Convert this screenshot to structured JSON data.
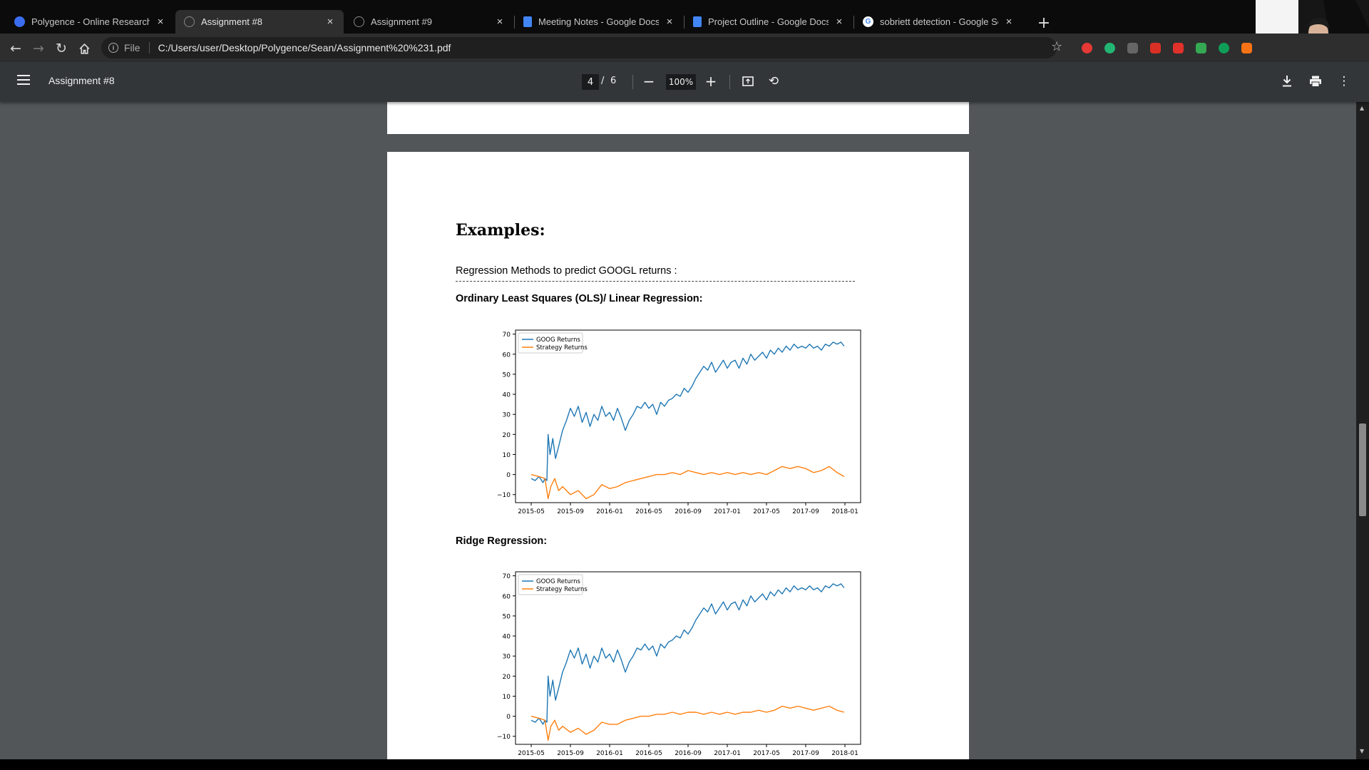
{
  "browser": {
    "tabs": [
      {
        "title": "Polygence - Online Research Opp",
        "icon": "polygence-icon",
        "color": "#3b6df0",
        "active": false
      },
      {
        "title": "Assignment #8",
        "icon": "globe-icon",
        "color": "#888888",
        "active": true
      },
      {
        "title": "Assignment #9",
        "icon": "globe-icon",
        "color": "#888888",
        "active": false
      },
      {
        "title": "Meeting Notes - Google Docs",
        "icon": "google-docs-icon",
        "color": "#4285f4",
        "active": false
      },
      {
        "title": "Project Outline - Google Docs",
        "icon": "google-docs-icon",
        "color": "#4285f4",
        "active": false
      },
      {
        "title": "sobriett detection - Google Search",
        "icon": "google-icon",
        "color": "#ffffff",
        "active": false
      }
    ],
    "tab_close_glyph": "×",
    "new_tab_glyph": "+",
    "omnibox": {
      "security_label": "File",
      "url": "C:/Users/user/Desktop/Polygence/Sean/Assignment%20%231.pdf"
    },
    "extensions": [
      "#e53935",
      "#22b573",
      "#666666",
      "#d93025",
      "#e0312b",
      "#34a853",
      "#0f9d58",
      "#f97316"
    ]
  },
  "pdf_viewer": {
    "title": "Assignment #8",
    "current_page": "4",
    "page_separator": "/",
    "total_pages": "6",
    "zoom": "100%"
  },
  "document": {
    "heading": "Examples:",
    "intro": "Regression Methods to predict GOOGL returns :",
    "sections": [
      {
        "title": "Ordinary Least Squares (OLS)/ Linear Regression:"
      },
      {
        "title": "Ridge Regression:"
      }
    ]
  },
  "chart_data": [
    {
      "type": "line",
      "x_tick_labels": [
        "2015-05",
        "2015-09",
        "2016-01",
        "2016-05",
        "2016-09",
        "2017-01",
        "2017-05",
        "2017-09",
        "2018-01"
      ],
      "y_ticks": [
        -10,
        0,
        10,
        20,
        30,
        40,
        50,
        60,
        70
      ],
      "ylim": [
        -14,
        72
      ],
      "legend": "top-left",
      "series": [
        {
          "name": "GOOG Returns",
          "color": "#1f77b4",
          "x": [
            0,
            0.1,
            0.2,
            0.3,
            0.35,
            0.4,
            0.43,
            0.48,
            0.55,
            0.62,
            0.7,
            0.8,
            0.9,
            1.0,
            1.1,
            1.2,
            1.3,
            1.4,
            1.5,
            1.6,
            1.7,
            1.8,
            1.9,
            2.0,
            2.1,
            2.2,
            2.3,
            2.4,
            2.5,
            2.6,
            2.7,
            2.8,
            2.9,
            3.0,
            3.1,
            3.2,
            3.3,
            3.4,
            3.5,
            3.6,
            3.7,
            3.8,
            3.9,
            4.0,
            4.1,
            4.2,
            4.3,
            4.4,
            4.5,
            4.6,
            4.7,
            4.8,
            4.9,
            5.0,
            5.1,
            5.2,
            5.3,
            5.4,
            5.5,
            5.6,
            5.7,
            5.8,
            5.9,
            6.0,
            6.1,
            6.2,
            6.3,
            6.4,
            6.5,
            6.6,
            6.7,
            6.8,
            6.9,
            7.0,
            7.1,
            7.2,
            7.3,
            7.4,
            7.5,
            7.6,
            7.7,
            7.8,
            7.9,
            7.98
          ],
          "y": [
            -2,
            -3,
            -1,
            -4,
            -2,
            -3,
            20,
            10,
            18,
            8,
            14,
            22,
            27,
            33,
            29,
            34,
            26,
            31,
            24,
            30,
            27,
            34,
            29,
            31,
            27,
            33,
            28,
            22,
            27,
            30,
            34,
            33,
            36,
            33,
            35,
            30,
            36,
            34,
            37,
            38,
            40,
            39,
            43,
            41,
            44,
            48,
            51,
            54,
            52,
            56,
            51,
            54,
            57,
            53,
            56,
            57,
            53,
            58,
            55,
            60,
            57,
            59,
            61,
            58,
            62,
            60,
            63,
            61,
            64,
            62,
            65,
            63,
            64,
            63,
            65,
            63,
            64,
            62,
            65,
            64,
            66,
            65,
            66,
            64
          ]
        },
        {
          "name": "Strategy Returns",
          "color": "#ff7f0e",
          "x": [
            0,
            0.2,
            0.35,
            0.43,
            0.5,
            0.6,
            0.7,
            0.8,
            1.0,
            1.2,
            1.4,
            1.6,
            1.8,
            2.0,
            2.2,
            2.4,
            2.6,
            2.8,
            3.0,
            3.2,
            3.4,
            3.6,
            3.8,
            4.0,
            4.2,
            4.4,
            4.6,
            4.8,
            5.0,
            5.2,
            5.4,
            5.6,
            5.8,
            6.0,
            6.2,
            6.4,
            6.6,
            6.8,
            7.0,
            7.2,
            7.4,
            7.6,
            7.8,
            7.98
          ],
          "y": [
            0,
            -1,
            -2,
            -12,
            -6,
            -2,
            -8,
            -6,
            -10,
            -8,
            -12,
            -10,
            -5,
            -7,
            -6,
            -4,
            -3,
            -2,
            -1,
            0,
            0,
            1,
            0,
            2,
            1,
            0,
            1,
            0,
            1,
            0,
            1,
            0,
            1,
            0,
            2,
            4,
            3,
            4,
            3,
            1,
            2,
            4,
            1,
            -1
          ]
        }
      ]
    },
    {
      "type": "line",
      "x_tick_labels": [
        "2015-05",
        "2015-09",
        "2016-01",
        "2016-05",
        "2016-09",
        "2017-01",
        "2017-05",
        "2017-09",
        "2018-01"
      ],
      "y_ticks": [
        -10,
        0,
        10,
        20,
        30,
        40,
        50,
        60,
        70
      ],
      "ylim": [
        -14,
        72
      ],
      "legend": "top-left",
      "series": [
        {
          "name": "GOOG Returns",
          "color": "#1f77b4",
          "x": [
            0,
            0.1,
            0.2,
            0.3,
            0.35,
            0.4,
            0.43,
            0.48,
            0.55,
            0.62,
            0.7,
            0.8,
            0.9,
            1.0,
            1.1,
            1.2,
            1.3,
            1.4,
            1.5,
            1.6,
            1.7,
            1.8,
            1.9,
            2.0,
            2.1,
            2.2,
            2.3,
            2.4,
            2.5,
            2.6,
            2.7,
            2.8,
            2.9,
            3.0,
            3.1,
            3.2,
            3.3,
            3.4,
            3.5,
            3.6,
            3.7,
            3.8,
            3.9,
            4.0,
            4.1,
            4.2,
            4.3,
            4.4,
            4.5,
            4.6,
            4.7,
            4.8,
            4.9,
            5.0,
            5.1,
            5.2,
            5.3,
            5.4,
            5.5,
            5.6,
            5.7,
            5.8,
            5.9,
            6.0,
            6.1,
            6.2,
            6.3,
            6.4,
            6.5,
            6.6,
            6.7,
            6.8,
            6.9,
            7.0,
            7.1,
            7.2,
            7.3,
            7.4,
            7.5,
            7.6,
            7.7,
            7.8,
            7.9,
            7.98
          ],
          "y": [
            -2,
            -3,
            -1,
            -4,
            -2,
            -3,
            20,
            10,
            18,
            8,
            14,
            22,
            27,
            33,
            29,
            34,
            26,
            31,
            24,
            30,
            27,
            34,
            29,
            31,
            27,
            33,
            28,
            22,
            27,
            30,
            34,
            33,
            36,
            33,
            35,
            30,
            36,
            34,
            37,
            38,
            40,
            39,
            43,
            41,
            44,
            48,
            51,
            54,
            52,
            56,
            51,
            54,
            57,
            53,
            56,
            57,
            53,
            58,
            55,
            60,
            57,
            59,
            61,
            58,
            62,
            60,
            63,
            61,
            64,
            62,
            65,
            63,
            64,
            63,
            65,
            63,
            64,
            62,
            65,
            64,
            66,
            65,
            66,
            64
          ]
        },
        {
          "name": "Strategy Returns",
          "color": "#ff7f0e",
          "x": [
            0,
            0.2,
            0.35,
            0.43,
            0.5,
            0.6,
            0.7,
            0.8,
            1.0,
            1.2,
            1.4,
            1.6,
            1.8,
            2.0,
            2.2,
            2.4,
            2.6,
            2.8,
            3.0,
            3.2,
            3.4,
            3.6,
            3.8,
            4.0,
            4.2,
            4.4,
            4.6,
            4.8,
            5.0,
            5.2,
            5.4,
            5.6,
            5.8,
            6.0,
            6.2,
            6.4,
            6.6,
            6.8,
            7.0,
            7.2,
            7.4,
            7.6,
            7.8,
            7.98
          ],
          "y": [
            0,
            -1,
            -2,
            -12,
            -5,
            -2,
            -7,
            -5,
            -8,
            -6,
            -9,
            -7,
            -3,
            -4,
            -4,
            -2,
            -1,
            0,
            0,
            1,
            1,
            2,
            1,
            2,
            2,
            1,
            2,
            1,
            2,
            1,
            2,
            2,
            3,
            2,
            3,
            5,
            4,
            5,
            4,
            3,
            4,
            5,
            3,
            2
          ]
        }
      ]
    }
  ]
}
